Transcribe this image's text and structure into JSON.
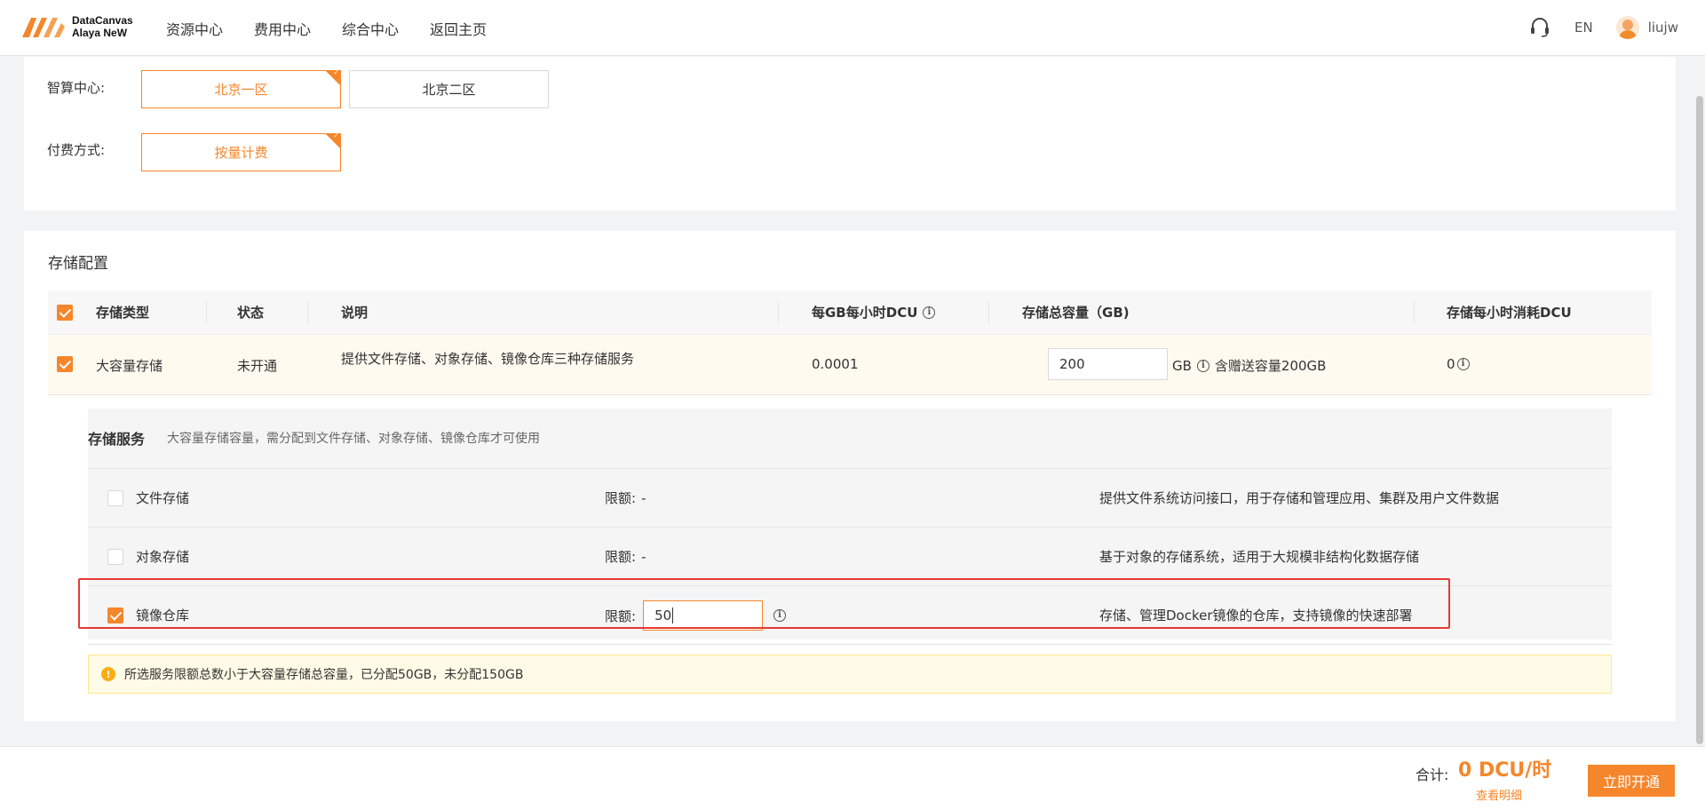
{
  "brand": {
    "line1": "DataCanvas",
    "line2": "Alaya NeW"
  },
  "nav": [
    "资源中心",
    "费用中心",
    "综合中心",
    "返回主页"
  ],
  "header_right": {
    "support_icon": "headset-icon",
    "lang": "EN",
    "user": "liujw"
  },
  "zone": {
    "label": "智算中心:",
    "options": [
      "北京一区",
      "北京二区"
    ],
    "selected": "北京一区"
  },
  "billing": {
    "label": "付费方式:",
    "options": [
      "按量计费"
    ],
    "selected": "按量计费"
  },
  "storage": {
    "title": "存储配置",
    "headers": [
      "存储类型",
      "状态",
      "说明",
      "每GB每小时DCU",
      "存储总容量（GB)",
      "存储每小时消耗DCU"
    ],
    "row": {
      "type": "大容量存储",
      "status": "未开通",
      "desc": "提供文件存储、对象存储、镜像仓库三种存储服务",
      "price": "0.0001",
      "capacity": "200",
      "unit": "GB",
      "bonus": "含赠送容量200GB",
      "consume": "0"
    }
  },
  "services": {
    "title": "存储服务",
    "desc": "大容量存储容量，需分配到文件存储、对象存储、镜像仓库才可使用",
    "quota_label": "限额:",
    "items": [
      {
        "name": "文件存储",
        "checked": false,
        "quota": "-",
        "desc": "提供文件系统访问接口，用于存储和管理应用、集群及用户文件数据"
      },
      {
        "name": "对象存储",
        "checked": false,
        "quota": "-",
        "desc": "基于对象的存储系统，适用于大规模非结构化数据存储"
      },
      {
        "name": "镜像仓库",
        "checked": true,
        "quota": "50",
        "desc": "存储、管理Docker镜像的仓库，支持镜像的快速部署"
      }
    ]
  },
  "warning": "所选服务限额总数小于大容量存储总容量，已分配50GB，未分配150GB",
  "footer": {
    "total_label": "合计:",
    "total_value": "0 DCU/时",
    "detail": "查看明细",
    "submit": "立即开通"
  },
  "colors": {
    "accent": "#f5862b",
    "highlight": "#e53935"
  }
}
